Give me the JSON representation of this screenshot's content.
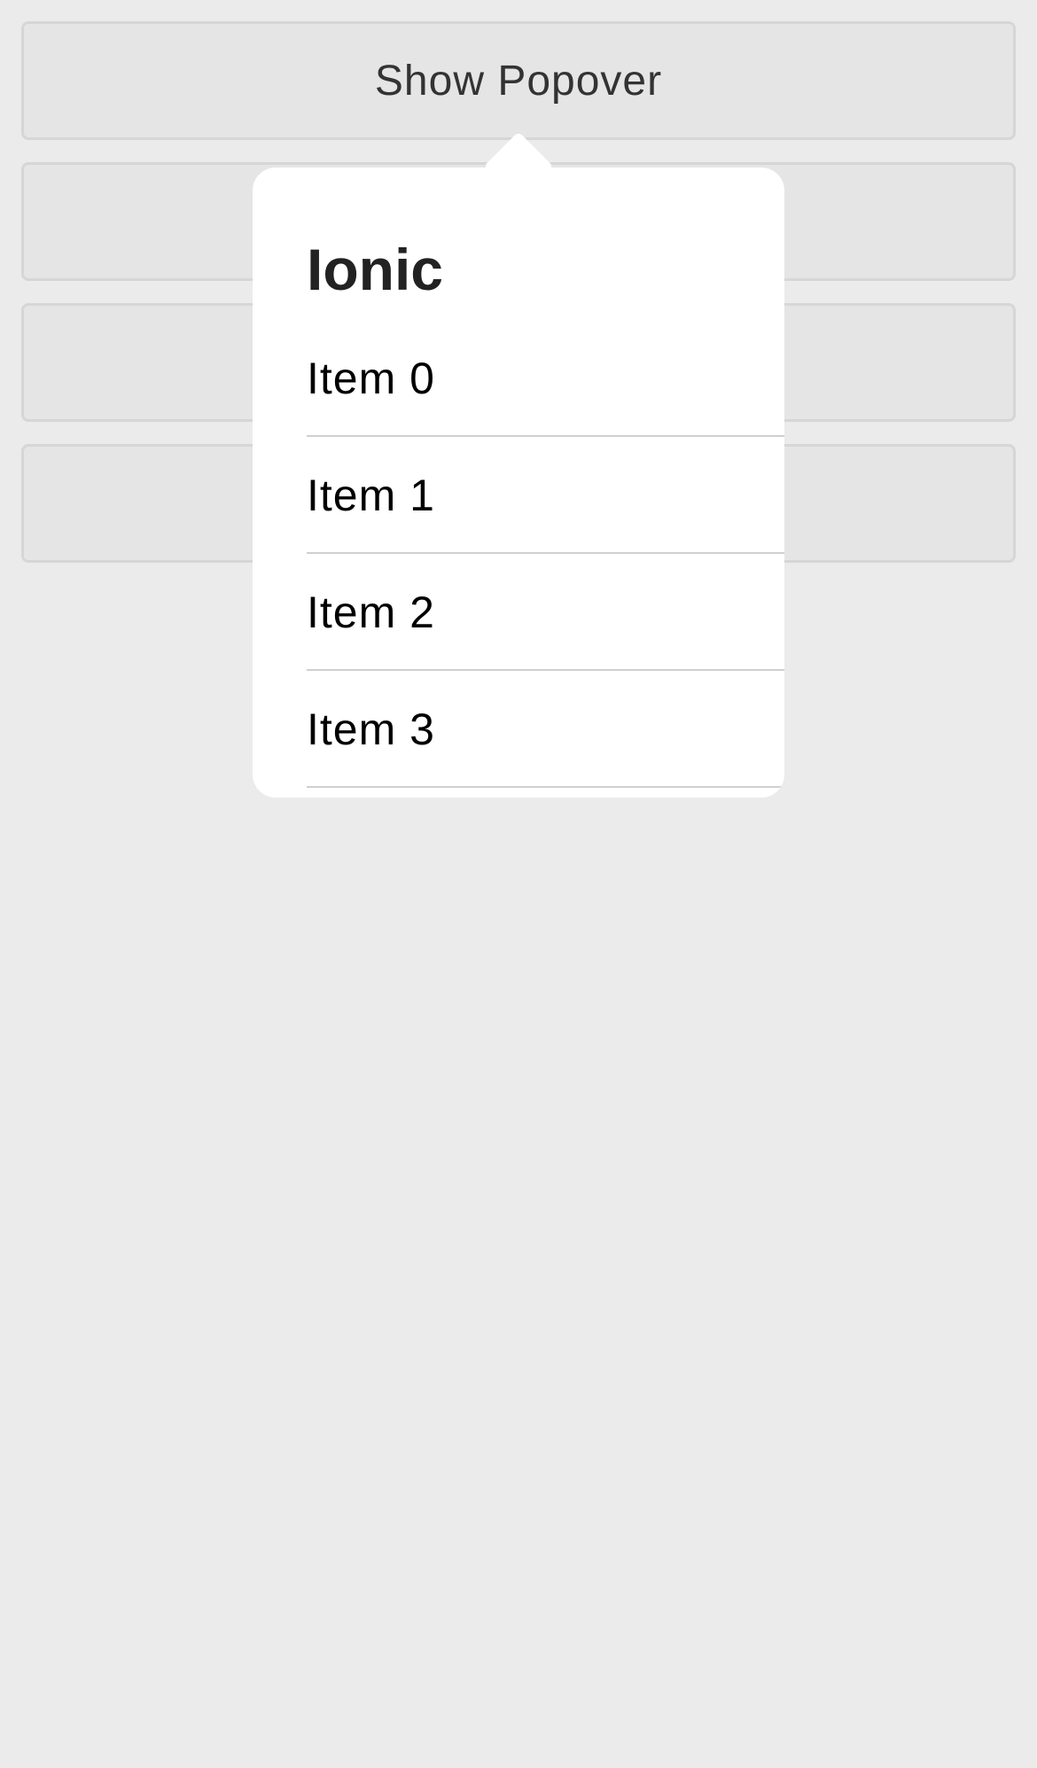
{
  "buttons": [
    {
      "label": "Show Popover"
    },
    {
      "label": ""
    },
    {
      "label": ""
    },
    {
      "label": ""
    }
  ],
  "popover": {
    "title": "Ionic",
    "items": [
      {
        "label": "Item 0"
      },
      {
        "label": "Item 1"
      },
      {
        "label": "Item 2"
      },
      {
        "label": "Item 3"
      }
    ]
  }
}
